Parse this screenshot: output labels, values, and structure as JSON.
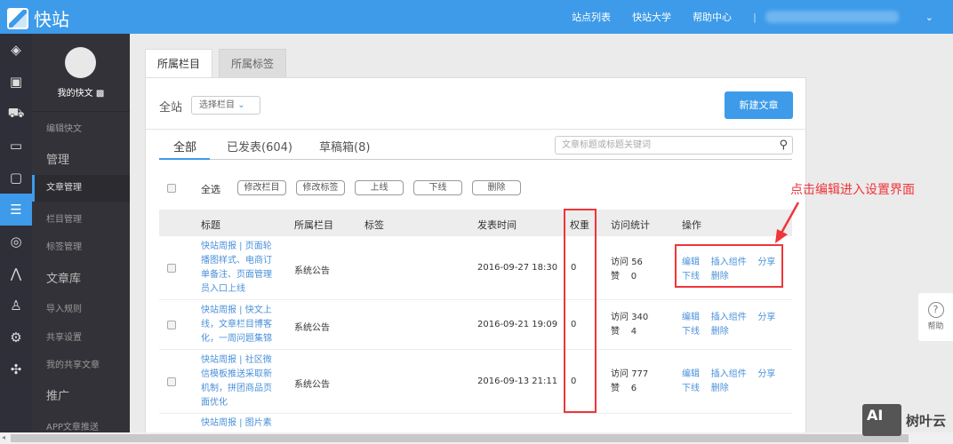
{
  "header": {
    "brand": "快站",
    "nav": [
      "站点列表",
      "快站大学",
      "帮助中心"
    ]
  },
  "rail_icons": [
    "layers-icon",
    "page-icon",
    "cart-icon",
    "chat-icon",
    "edit-doc-icon",
    "article-icon",
    "wechat-icon",
    "compass-icon",
    "user-icon",
    "settings-icon",
    "plugin-icon"
  ],
  "sidebar": {
    "username": "我的快文",
    "edit": "编辑快文",
    "manage": "管理",
    "items": [
      "文章管理",
      "栏目管理",
      "标签管理"
    ],
    "library": "文章库",
    "lib_items": [
      "导入规则",
      "共享设置",
      "我的共享文章"
    ],
    "promote": "推广",
    "promo_items": [
      "APP文章推送"
    ]
  },
  "tabs": [
    "所属栏目",
    "所属标签"
  ],
  "filter": {
    "label": "全站",
    "select": "选择栏目",
    "new_button": "新建文章"
  },
  "subtabs": [
    "全部",
    "已发表(604)",
    "草稿箱(8)"
  ],
  "search": {
    "placeholder": "文章标题或标题关键词"
  },
  "bulk": {
    "select_all": "全选",
    "actions": [
      "修改栏目",
      "修改标签",
      "上线",
      "下线",
      "删除"
    ]
  },
  "table": {
    "headers": [
      "标题",
      "所属栏目",
      "标签",
      "发表时间",
      "权重",
      "访问统计",
      "操作"
    ],
    "visit_label": "访问",
    "like_label": "赞",
    "ops": [
      "编辑",
      "插入组件",
      "分享",
      "下线",
      "删除"
    ],
    "rows": [
      {
        "title": "快站周报 | 页面轮播图样式、电商订单备注、页面管理员入口上线",
        "column": "系统公告",
        "time": "2016-09-27 18:30",
        "weight": "0",
        "visits": "56",
        "likes": "0"
      },
      {
        "title": "快站周报 | 快文上线，文章栏目博客化，一周问题集锦",
        "column": "系统公告",
        "time": "2016-09-21 19:09",
        "weight": "0",
        "visits": "340",
        "likes": "4"
      },
      {
        "title": "快站周报 | 社区微信模板推送采取新机制，拼团商品页面优化",
        "column": "系统公告",
        "time": "2016-09-13 21:11",
        "weight": "0",
        "visits": "777",
        "likes": "6"
      },
      {
        "title": "快站周报 | 图片素"
      }
    ]
  },
  "annotation": "点击编辑进入设置界面",
  "help": "帮助",
  "watermark": "树叶云"
}
